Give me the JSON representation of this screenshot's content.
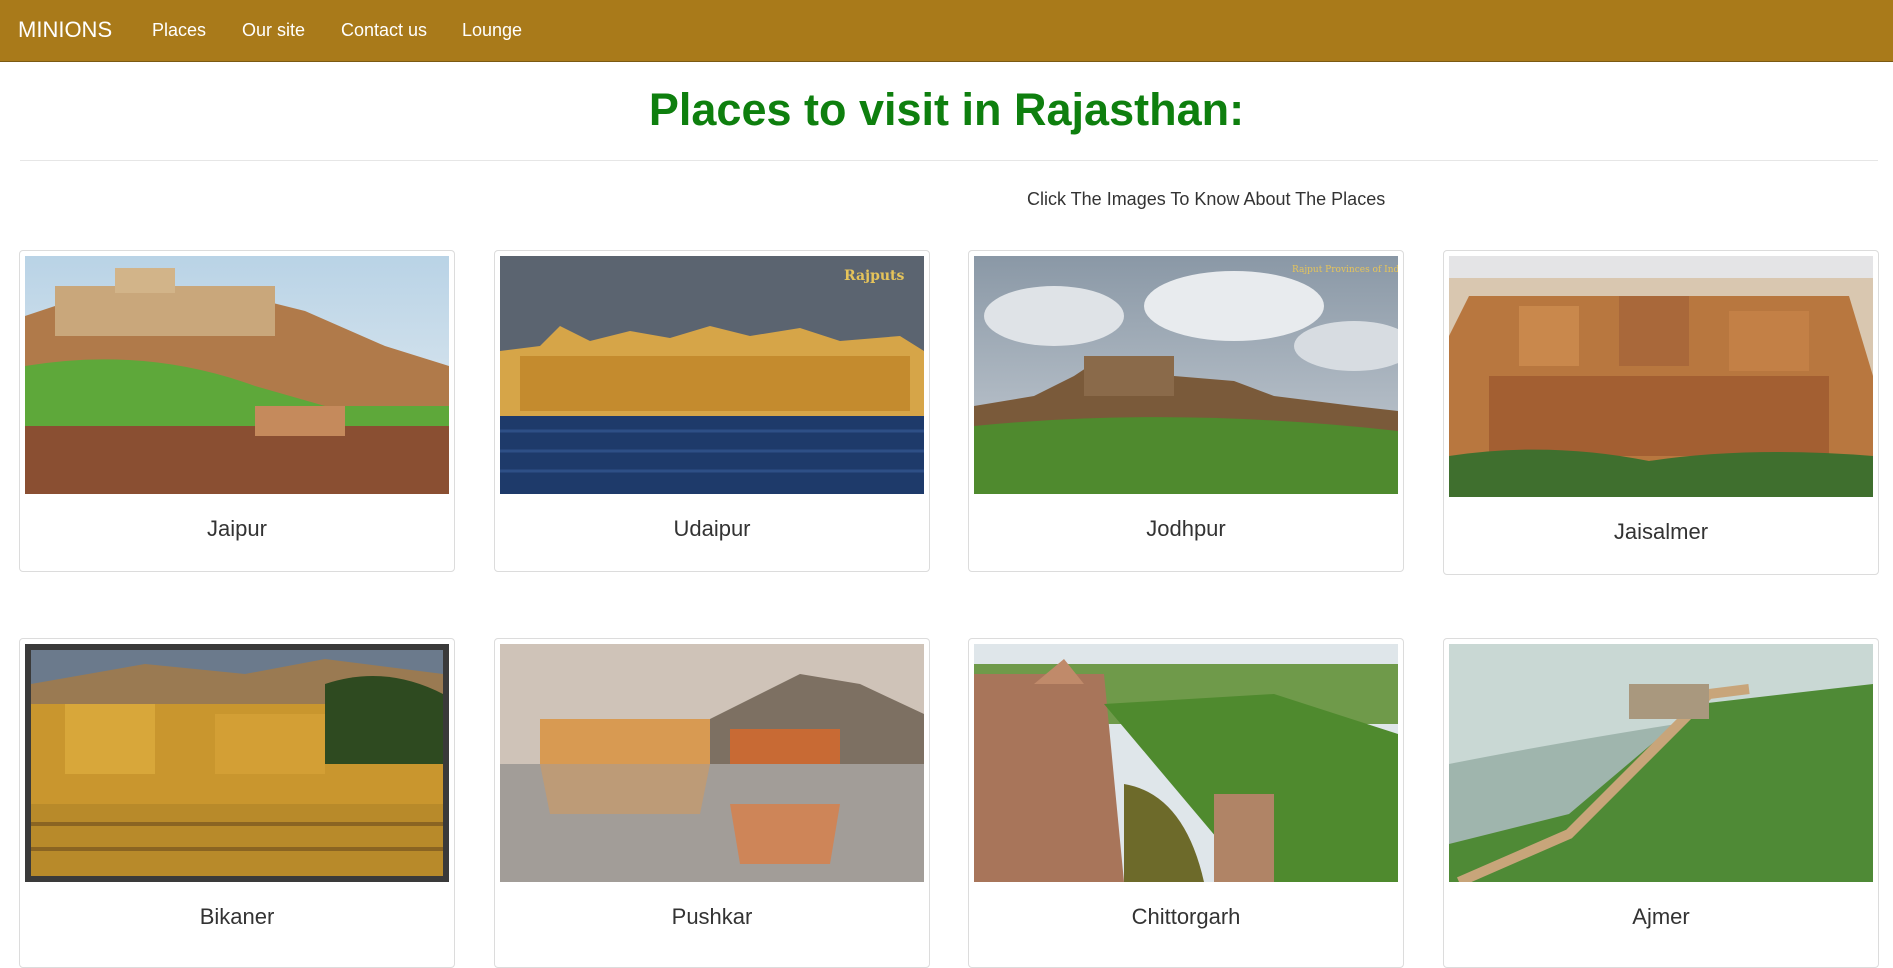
{
  "navbar": {
    "brand": "MINIONS",
    "links": [
      "Places",
      "Our site",
      "Contact us",
      "Lounge"
    ]
  },
  "page": {
    "title": "Places to visit in Rajasthan:",
    "hint": "Click The Images To Know About The Places"
  },
  "places": [
    {
      "name": "Jaipur"
    },
    {
      "name": "Udaipur"
    },
    {
      "name": "Jodhpur"
    },
    {
      "name": "Jaisalmer"
    },
    {
      "name": "Bikaner"
    },
    {
      "name": "Pushkar"
    },
    {
      "name": "Chittorgarh"
    },
    {
      "name": "Ajmer"
    }
  ],
  "watermarks": {
    "udaipur": "Rajputs",
    "jodhpur": "Rajput Provinces of India"
  },
  "colors": {
    "navbar": "#a97a1a",
    "title": "#0e7f0e"
  }
}
